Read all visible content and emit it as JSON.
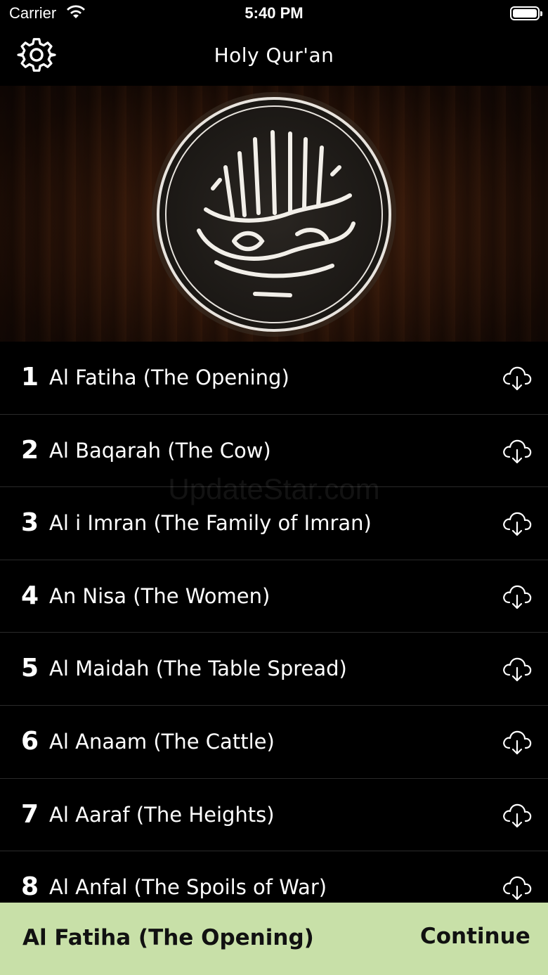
{
  "status_bar": {
    "carrier": "Carrier",
    "time": "5:40 PM"
  },
  "nav": {
    "title": "Holy Qur'an"
  },
  "surahs": [
    {
      "number": "1",
      "name": "Al Fatiha (The Opening)"
    },
    {
      "number": "2",
      "name": "Al Baqarah (The Cow)"
    },
    {
      "number": "3",
      "name": "Al i Imran (The Family of Imran)"
    },
    {
      "number": "4",
      "name": "An Nisa (The Women)"
    },
    {
      "number": "5",
      "name": "Al Maidah (The Table Spread)"
    },
    {
      "number": "6",
      "name": "Al Anaam (The Cattle)"
    },
    {
      "number": "7",
      "name": "Al Aaraf (The Heights)"
    },
    {
      "number": "8",
      "name": "Al Anfal (The Spoils of War)"
    }
  ],
  "watermark": "UpdateStar.com",
  "bottom_bar": {
    "current": "Al Fatiha (The Opening)",
    "continue_label": "Continue"
  },
  "colors": {
    "background": "#000000",
    "bottom_bar": "#c8e0a8",
    "text": "#ffffff"
  },
  "icons": {
    "settings": "gear-icon",
    "download": "cloud-download-icon",
    "wifi": "wifi-icon",
    "battery": "battery-icon"
  }
}
